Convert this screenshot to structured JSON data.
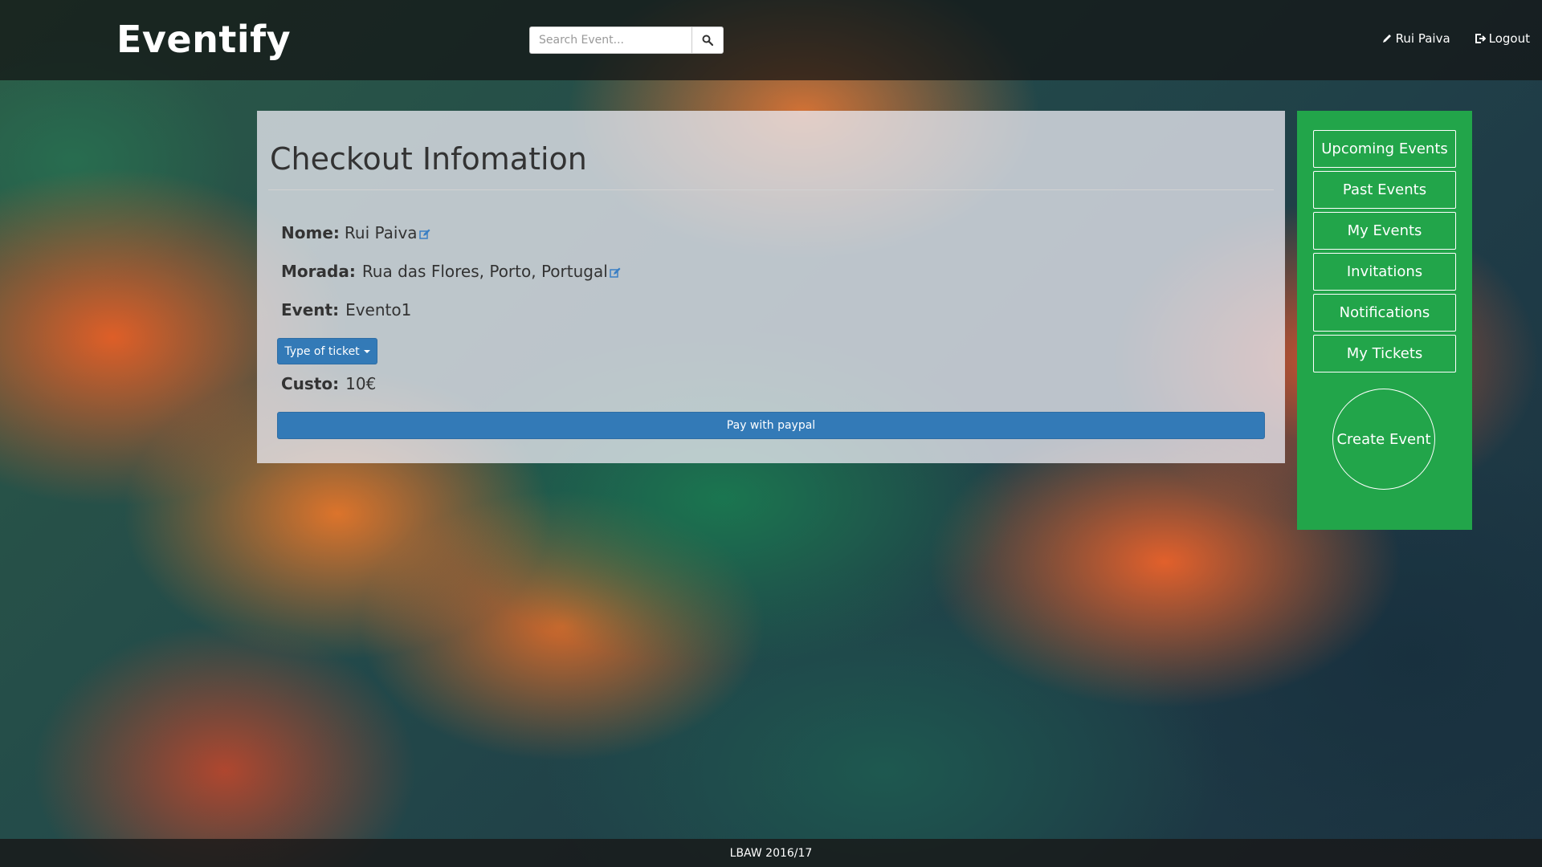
{
  "navbar": {
    "brand": "Eventify",
    "search": {
      "placeholder": "Search Event...",
      "value": ""
    },
    "user_link": "Rui Paiva",
    "logout_link": "Logout"
  },
  "checkout": {
    "title": "Checkout Infomation",
    "nome": {
      "label": "Nome:",
      "value": "Rui Paiva"
    },
    "morada": {
      "label": "Morada:",
      "value": "Rua das Flores, Porto, Portugal"
    },
    "event": {
      "label": "Event:",
      "value": "Evento1"
    },
    "ticket_dropdown_label": "Type of ticket",
    "custo": {
      "label": "Custo:",
      "value": "10€"
    },
    "pay_button": "Pay with paypal"
  },
  "sidebar": {
    "items": [
      {
        "label": "Upcoming Events"
      },
      {
        "label": "Past Events"
      },
      {
        "label": "My Events"
      },
      {
        "label": "Invitations"
      },
      {
        "label": "Notifications"
      },
      {
        "label": "My Tickets"
      }
    ],
    "create_button": "Create Event"
  },
  "footer": {
    "text": "LBAW 2016/17"
  },
  "colors": {
    "primary_button": "#337ab7",
    "sidebar_green": "#22a54a",
    "navbar_dark": "#141414",
    "edit_icon_blue": "#3a7fc4"
  },
  "icons": {
    "search": "search-icon",
    "user": "pencil-icon",
    "logout": "logout-icon",
    "edit": "edit-icon"
  }
}
